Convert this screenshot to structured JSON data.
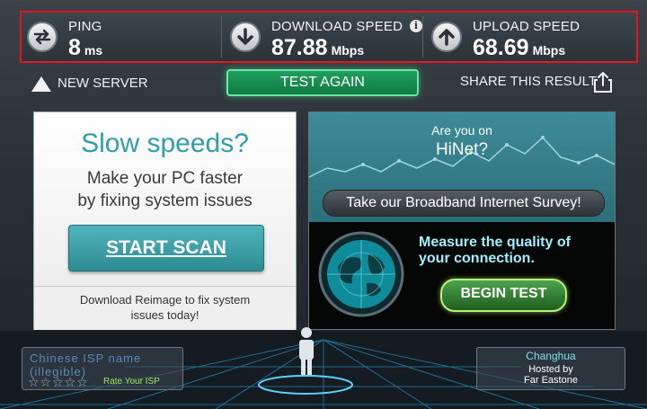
{
  "metrics": {
    "ping": {
      "label": "PING",
      "value": "8",
      "unit": "ms"
    },
    "download": {
      "label": "DOWNLOAD SPEED",
      "value": "87.88",
      "unit": "Mbps",
      "info": "i"
    },
    "upload": {
      "label": "UPLOAD SPEED",
      "value": "68.69",
      "unit": "Mbps"
    }
  },
  "actions": {
    "new_server": "NEW SERVER",
    "test_again": "TEST AGAIN",
    "share": "SHARE THIS RESULT"
  },
  "left_ad": {
    "headline": "Slow speeds?",
    "sub1": "Make your PC faster",
    "sub2": "by fixing system issues",
    "button": "START SCAN",
    "footer1": "Download Reimage to fix system",
    "footer2": "issues today!"
  },
  "right_ad": {
    "q1": "Are you on",
    "q2": "HiNet?",
    "survey_button": "Take our Broadband Internet Survey!",
    "measure1": "Measure the quality of",
    "measure2": "your connection.",
    "begin_button": "BEGIN TEST"
  },
  "isp": {
    "rate_label": "Rate Your ISP",
    "stars": "☆☆☆☆☆",
    "name": "Chinese ISP name (illegible)"
  },
  "server": {
    "city": "Changhua",
    "hosted_by": "Hosted by",
    "host": "Far Eastone"
  },
  "colors": {
    "highlight_border": "#e0171e",
    "test_again_green": "#1f9f5d",
    "scan_teal": "#3ea3ab",
    "begin_green": "#4ea24e"
  }
}
